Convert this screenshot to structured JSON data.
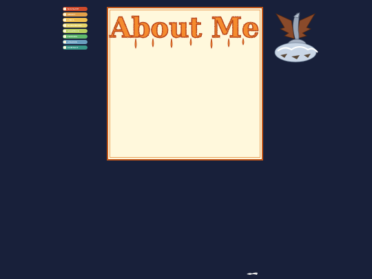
{
  "nav": {
    "items": [
      {
        "label": "NAVIGATE",
        "color": "#d04a2a"
      },
      {
        "label": "ABOUT",
        "color": "#e3a14a"
      },
      {
        "label": "LINKS",
        "color": "#f0c050"
      },
      {
        "label": "GUESTBOOK",
        "color": "#e8d66a"
      },
      {
        "label": "GRAPHICS",
        "color": "#b8d060"
      },
      {
        "label": "FRIENDS",
        "color": "#5fba6c"
      },
      {
        "label": "AWARDS",
        "color": "#6aa0c0"
      },
      {
        "label": "CONTACT",
        "color": "#3a9a8a"
      }
    ]
  },
  "header": {
    "title": "About Me"
  },
  "colors": {
    "background": "#18203a",
    "panel_border": "#c0561a",
    "panel_fill": "#fff8dc",
    "title_fill": "#f58b2e"
  },
  "icons": {
    "dragon": "dragon-emblem-icon",
    "footer": "small-logo-icon"
  }
}
